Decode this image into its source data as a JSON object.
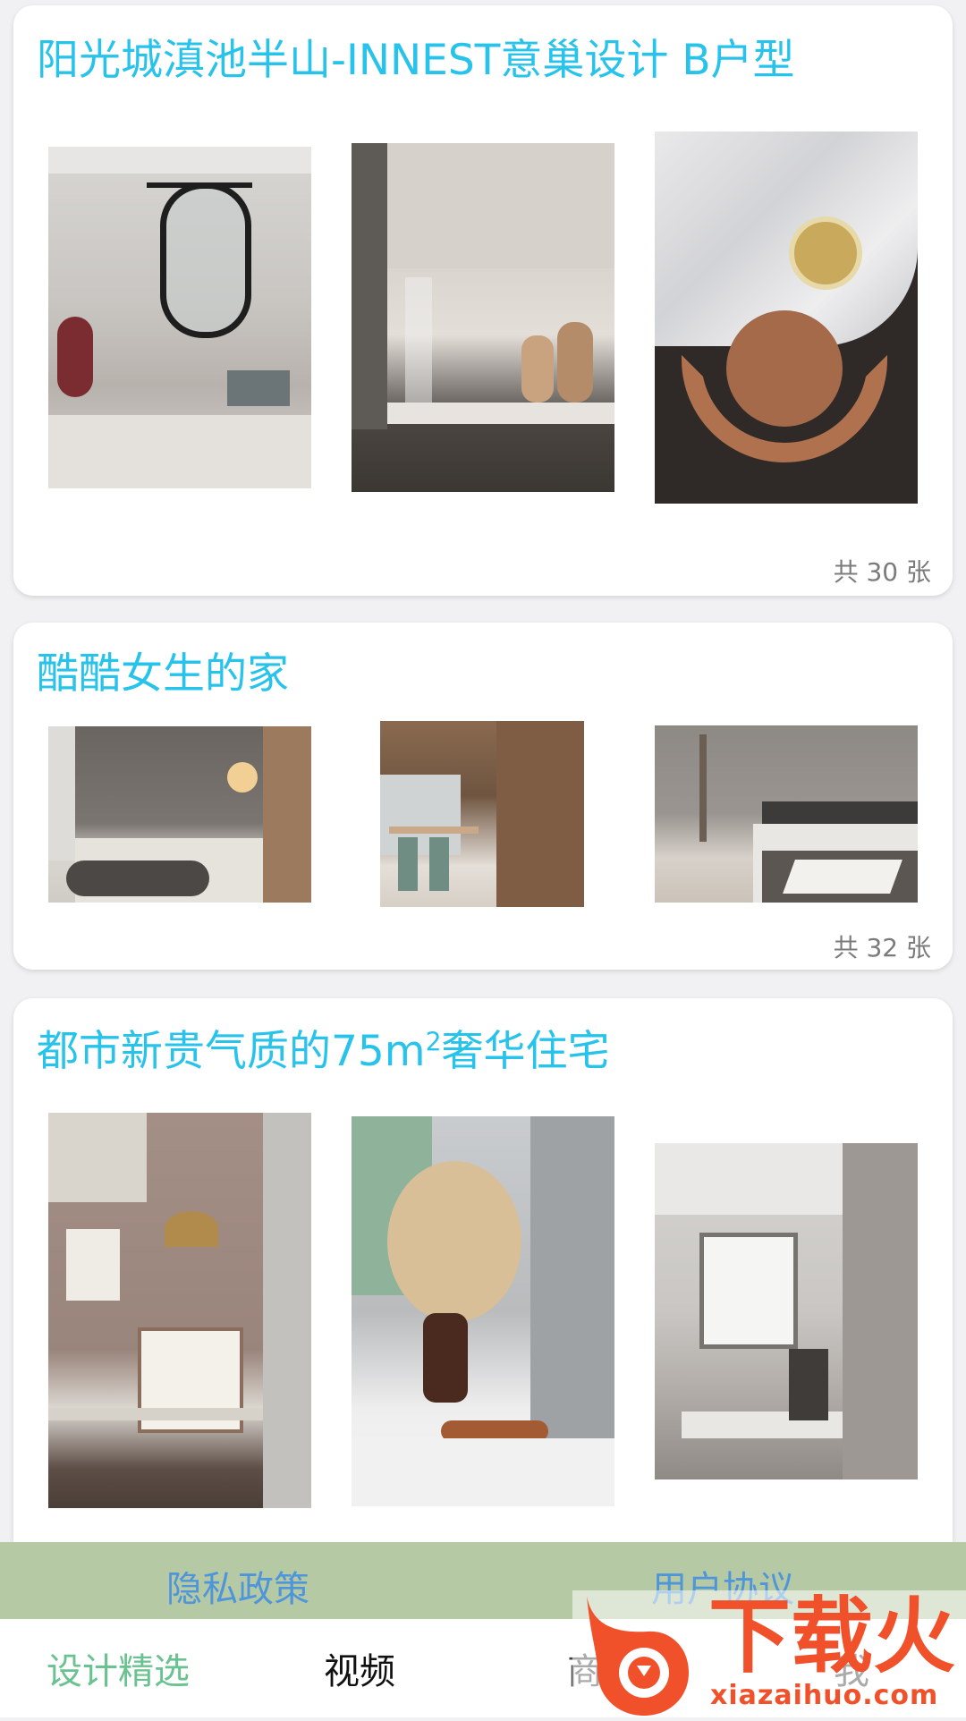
{
  "cards": [
    {
      "title": "阳光城滇池半山-INNEST意巢设计 B户型",
      "count": "共 30 张"
    },
    {
      "title": "酷酷女生的家",
      "count": "共 32 张"
    },
    {
      "title_main": "都市新贵气质的75m",
      "title_sup": "2",
      "title_tail": "奢华住宅"
    }
  ],
  "policy_bar": {
    "privacy": "隐私政策",
    "agreement": "用户协议"
  },
  "tabs": [
    "设计精选",
    "视频",
    "商店",
    "我"
  ],
  "watermark": {
    "brand": "下载火",
    "url": "xiazaihuo.com"
  },
  "colors": {
    "title": "#27c3ea",
    "policy_bg": "#b5c9a4",
    "policy_link": "#4f95da",
    "tab_active": "#69c28f",
    "watermark_red": "#f0502a"
  }
}
